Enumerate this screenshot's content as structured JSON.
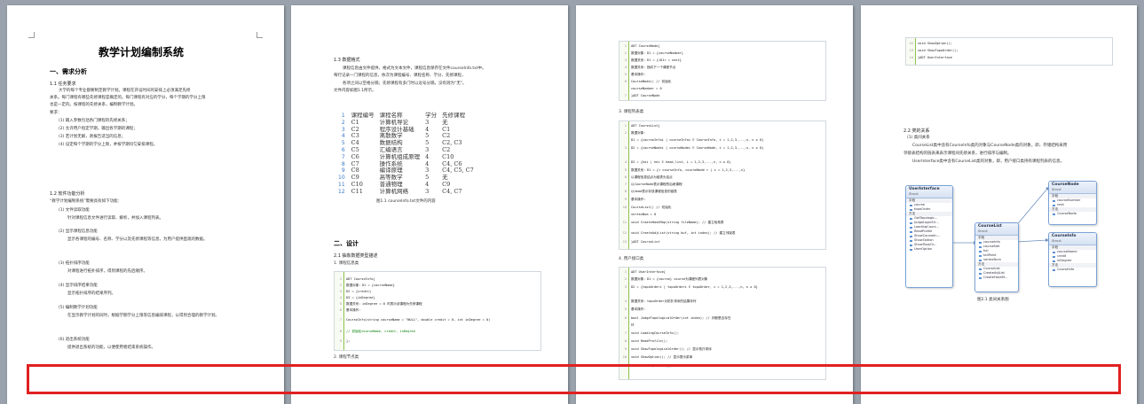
{
  "page1": {
    "title": "教学计划编制系统",
    "section1": "一、需求分析",
    "sub11": "1.1 任务要求",
    "body_a": "大学的每个专业都要制定教学计划。课程在开设时间的安排上必须满足先修",
    "body_b": "关系。每门课程有哪些先修课程是确定的。每门课程有对应的学分，每个学期的学分上限",
    "body_c": "也是一定的。按课程的先修关系，编制教学计划。",
    "req": "要求：",
    "list": [
      "(1) 输入参数包括各门课程的先修关系；",
      "(2) 允许用户指定学期，输出各学期的课程；",
      "(3) 若计划无解，则报告适当的信息；",
      "(4) 设定每个学期的学分上限，并按学期均匀安排课程。"
    ],
    "sub12": "1.2 软件功能分析",
    "intro12": "“教学计划编制系统”需要具有如下功能：",
    "func": [
      "(1) 文件读取功能",
      "针对课程信息文件进行读取、解析，并加入课程列表。",
      "(2) 显示课程信息功能",
      "显示各课程的编号、名称、学分以及先修课程等信息，为用户提供直观的数据。",
      "(3) 拓扑排序功能",
      "对课程进行拓扑排序，得到课程的先后顺序。",
      "(4) 显示排序结果功能",
      "显示拓扑排序的结果序列。",
      "(5) 编制教学计划功能",
      "在显示教学计划的同时，根据学期学分上限等信息编排课程，以得到合理的教学计划。",
      "(6) 退出系统功能",
      "提供退出系统的功能，以便使用者结束系统操作。"
    ]
  },
  "page2": {
    "sub13": "1.3 数据格式",
    "body_a": "课程信息由文件提供，格式为文本文件，课程信息保存在文件courseInfo.txt中。",
    "body_b": "每行记录一门课程的信息，依次为课程编号、课程名称、学分、先修课程，",
    "body_c": "各项之间以空格分隔；先修课程有多门时以逗号分隔，没有则为“无”。",
    "body_d": "文件内容如图1.1所示。",
    "table_header": [
      "课程编号",
      "课程名称",
      "学分",
      "先修课程"
    ],
    "rows": [
      [
        "C1",
        "计算机导论",
        "3",
        "无"
      ],
      [
        "C2",
        "程序设计基础",
        "4",
        "C1"
      ],
      [
        "C3",
        "离散数学",
        "5",
        "C2"
      ],
      [
        "C4",
        "数据结构",
        "5",
        "C2, C3"
      ],
      [
        "C5",
        "汇编语言",
        "3",
        "C2"
      ],
      [
        "C6",
        "计算机组成原理",
        "4",
        "C10"
      ],
      [
        "C7",
        "操作系统",
        "4",
        "C4, C6"
      ],
      [
        "C8",
        "编译原理",
        "3",
        "C4, C5, C7"
      ],
      [
        "C9",
        "高等数学",
        "5",
        "无"
      ],
      [
        "C10",
        "普通物理",
        "4",
        "C9"
      ],
      [
        "C11",
        "计算机网络",
        "3",
        "C4, C7"
      ]
    ],
    "caption": "图1.1 courseInfo.txt文件的内容",
    "section2": "二、设计",
    "sub21": "2.1 抽象数据类型描述",
    "item1": "1. 课程信息类",
    "code": [
      "ADT CourseInfo{",
      "    数据对象：D1 = {courseName}",
      "              D2 = {credit}",
      "              D3 = {inDegree}",
      "    数据关系：inDegree = 0 时表示该课程为先修课程",
      "    基本操作：",
      "        CourseInfo(string courseName = \"NULL\", double credit = 0, int inDegree = 0)",
      "                    // 初始化courseName, credit, inDegree",
      "};"
    ],
    "item2": "2. 课程节点类"
  },
  "page3": {
    "code1": [
      "ADT CourseNode{",
      "    数据对象：D1 = {courseNumber}",
      "    数据关系：R1 = {<D1> = next}",
      "    数据关系：指向下一个课程节点",
      "    基本操作：",
      "        CourseNode()      // 初始化",
      "courseNumber = 0",
      "}ADT CourseNode"
    ],
    "item3": "3. 课程列表类",
    "code2": [
      "ADT CourseList{",
      "    数据对象：",
      "D1 = {courseInfoi | courseInfoi ∈ CourseInfo, i = 1,2,3,...,n, n ≥ 0}",
      "          D2 = {courseNodei | courseNodei ∈ CourseNode, i = 1,2,3,...,n, n ≥ 0}",
      "          D3 = {hei | hei ∈ head_list, i = 1,2,3,...,n, n ≥ 0}",
      "    数据关系：R1 = {< courseInfo, courseNode > | i = 1,2,3,...,n}",
      "          以课程信息结点为链表头结点",
      "          以CourseNode表示课程的后继课程",
      "          以head表示存放课程信息的链表",
      "    基本操作：",
      "        CourseList()           // 初始化",
      "vertexNum = 0",
      "        void CreateHashMap(string fileName);   // 建立哈希表",
      "        void CreateAdjList(string buf, int index);   // 建立邻接表",
      "}ADT CourseList"
    ],
    "item4": "4. 用户接口类",
    "code3": [
      "ADT UserInterface{",
      "    数据对象：D1 = {course}  course为课程列表对象",
      "          D2 = {topoOrderi | topoOrderi ∈ topoOrder, i = 1,2,3,...,n, n ≥ 0}",
      "    数据关系：topoOrder为拓扑排序的结果序列",
      "    基本操作：",
      "        bool JudgeTopologicalOrder(int index);   // 判断是否存在",
      "环",
      "        void LoadingCourseInfo();",
      "        void ReadProfile();",
      "        void ShowTopologicalOrder();    // 显示拓扑排序",
      "        void ShowOption();             // 显示提示菜单",
      "        void ShowTopoOrder();"
    ]
  },
  "page4": {
    "code": [
      "void ShowOption();",
      "void ShowTopoOrder();",
      "}ADT UserInterface"
    ],
    "sub22": "2.2 类的关系",
    "sub221": "(1) 类间关系",
    "body_a": "CourseList类中含有CourseInfo类的对象与CourseNode类的对象，即，存储结构采用",
    "body_b": "邻接表结构的链表来表示课程间先修关系，进行排序与编制。",
    "body_c": "UserInterface类中含有CourseList类的对象，即，用户接口类持有课程列表的信息。",
    "caption": "图2.1 类间关系图",
    "classes": {
      "ui": {
        "name": "UserInterface",
        "stereo": "Struct",
        "sec1": "字段",
        "fields": [
          "course",
          "topoOrder"
        ],
        "sec2": "方法",
        "methods": [
          "GetTopologic...",
          "JudgeLogicErr...",
          "LoadingCours...",
          "ReadProfile",
          "ShowCourseIn...",
          "ShowOption",
          "ShowTopoOr...",
          "UserOption"
        ]
      },
      "list": {
        "name": "CourseList",
        "stereo": "Struct",
        "sec1": "字段",
        "fields": [
          "courseInfo",
          "courseNet",
          "hei",
          "tailPoint",
          "vertexNum"
        ],
        "sec2": "方法",
        "methods": [
          "CourseList",
          "CreateAdjList",
          "CreateHashM..."
        ]
      },
      "node": {
        "name": "CourseNode",
        "stereo": "Struct",
        "sec1": "字段",
        "fields": [
          "courseNumber",
          "next"
        ],
        "sec2": "方法",
        "methods": [
          "CourseNode"
        ]
      },
      "info": {
        "name": "CourseInfo",
        "stereo": "Struct",
        "sec1": "字段",
        "fields": [
          "courseName",
          "credit",
          "inDegree"
        ],
        "sec2": "方法",
        "methods": [
          "CourseInfo"
        ]
      }
    }
  },
  "colors": {
    "background": "#9aa3ad",
    "page": "#ffffff",
    "highlight": "#e02020",
    "code_gutter": "#8bc34a"
  }
}
